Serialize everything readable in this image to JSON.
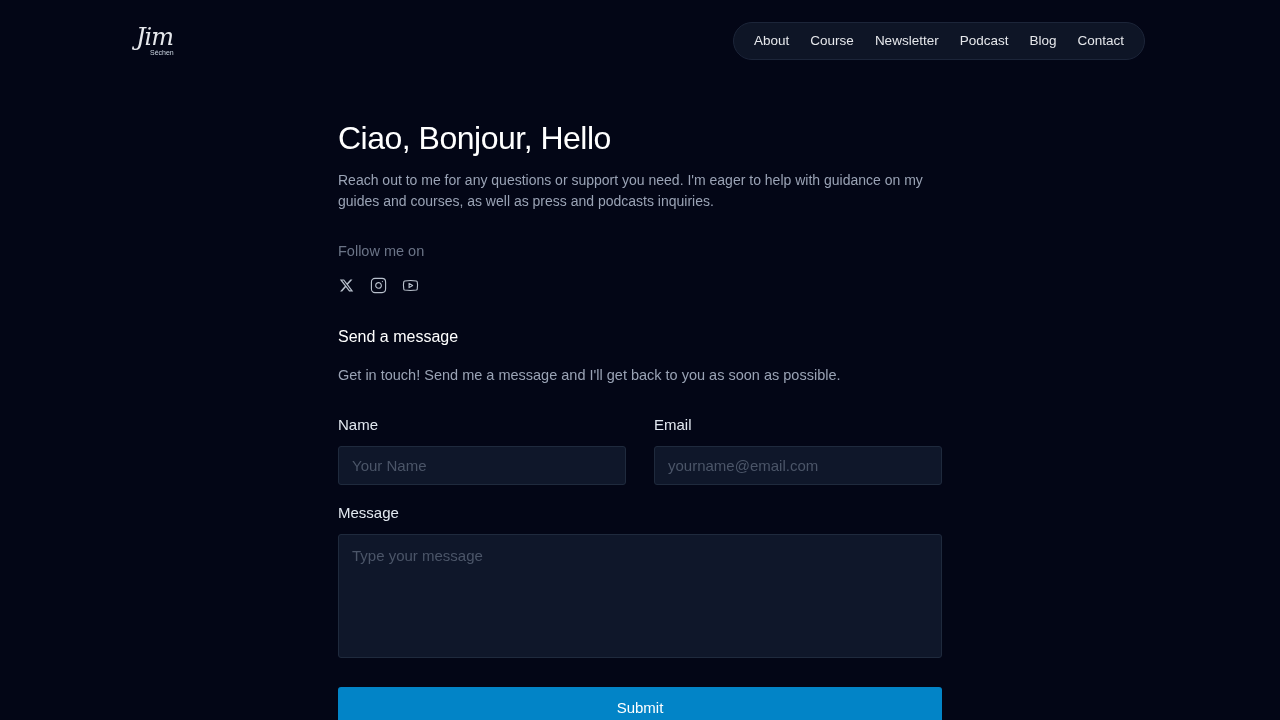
{
  "header": {
    "logo": {
      "signature": "Jim",
      "name": "Séchen"
    },
    "nav": [
      {
        "label": "About"
      },
      {
        "label": "Course"
      },
      {
        "label": "Newsletter"
      },
      {
        "label": "Podcast"
      },
      {
        "label": "Blog"
      },
      {
        "label": "Contact"
      }
    ]
  },
  "intro": {
    "title": "Ciao, Bonjour, Hello",
    "text": "Reach out to me for any questions or support you need. I'm eager to help with guidance on my guides and courses, as well as press and podcasts inquiries."
  },
  "social": {
    "label": "Follow me on",
    "links": [
      {
        "kind": "x"
      },
      {
        "kind": "instagram"
      },
      {
        "kind": "youtube"
      }
    ]
  },
  "contact_form": {
    "title": "Send a message",
    "description": "Get in touch! Send me a message and I'll get back to you as soon as possible.",
    "fields": [
      {
        "kind": "text",
        "label": "Name",
        "placeholder": "Your Name"
      },
      {
        "kind": "email",
        "label": "Email",
        "placeholder": "yourname@email.com"
      },
      {
        "kind": "textarea",
        "label": "Message",
        "placeholder": "Type your message"
      }
    ],
    "submit": "Submit"
  }
}
